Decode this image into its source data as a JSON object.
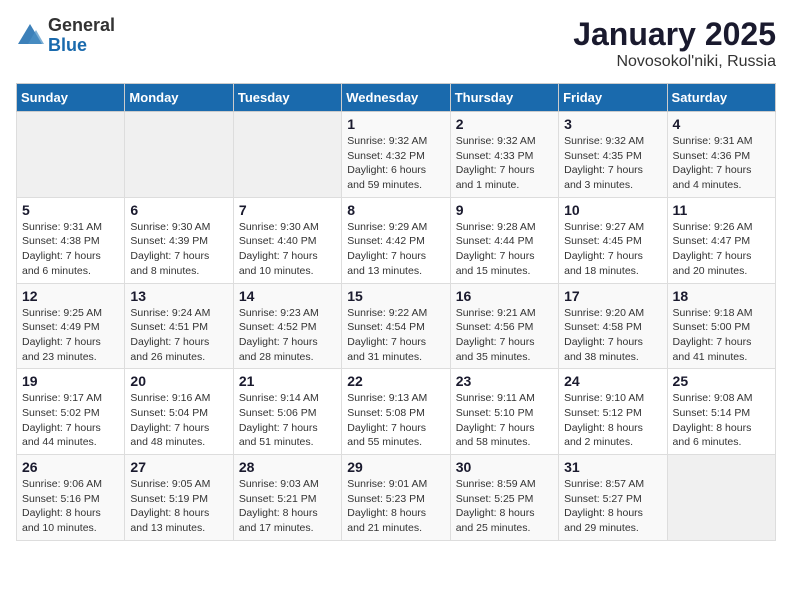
{
  "header": {
    "logo": {
      "general": "General",
      "blue": "Blue"
    },
    "title": "January 2025",
    "subtitle": "Novosokol'niki, Russia"
  },
  "weekdays": [
    "Sunday",
    "Monday",
    "Tuesday",
    "Wednesday",
    "Thursday",
    "Friday",
    "Saturday"
  ],
  "weeks": [
    [
      {
        "day": null
      },
      {
        "day": null
      },
      {
        "day": null
      },
      {
        "day": "1",
        "sunrise": "9:32 AM",
        "sunset": "4:32 PM",
        "daylight": "6 hours and 59 minutes."
      },
      {
        "day": "2",
        "sunrise": "9:32 AM",
        "sunset": "4:33 PM",
        "daylight": "7 hours and 1 minute."
      },
      {
        "day": "3",
        "sunrise": "9:32 AM",
        "sunset": "4:35 PM",
        "daylight": "7 hours and 3 minutes."
      },
      {
        "day": "4",
        "sunrise": "9:31 AM",
        "sunset": "4:36 PM",
        "daylight": "7 hours and 4 minutes."
      }
    ],
    [
      {
        "day": "5",
        "sunrise": "9:31 AM",
        "sunset": "4:38 PM",
        "daylight": "7 hours and 6 minutes."
      },
      {
        "day": "6",
        "sunrise": "9:30 AM",
        "sunset": "4:39 PM",
        "daylight": "7 hours and 8 minutes."
      },
      {
        "day": "7",
        "sunrise": "9:30 AM",
        "sunset": "4:40 PM",
        "daylight": "7 hours and 10 minutes."
      },
      {
        "day": "8",
        "sunrise": "9:29 AM",
        "sunset": "4:42 PM",
        "daylight": "7 hours and 13 minutes."
      },
      {
        "day": "9",
        "sunrise": "9:28 AM",
        "sunset": "4:44 PM",
        "daylight": "7 hours and 15 minutes."
      },
      {
        "day": "10",
        "sunrise": "9:27 AM",
        "sunset": "4:45 PM",
        "daylight": "7 hours and 18 minutes."
      },
      {
        "day": "11",
        "sunrise": "9:26 AM",
        "sunset": "4:47 PM",
        "daylight": "7 hours and 20 minutes."
      }
    ],
    [
      {
        "day": "12",
        "sunrise": "9:25 AM",
        "sunset": "4:49 PM",
        "daylight": "7 hours and 23 minutes."
      },
      {
        "day": "13",
        "sunrise": "9:24 AM",
        "sunset": "4:51 PM",
        "daylight": "7 hours and 26 minutes."
      },
      {
        "day": "14",
        "sunrise": "9:23 AM",
        "sunset": "4:52 PM",
        "daylight": "7 hours and 28 minutes."
      },
      {
        "day": "15",
        "sunrise": "9:22 AM",
        "sunset": "4:54 PM",
        "daylight": "7 hours and 31 minutes."
      },
      {
        "day": "16",
        "sunrise": "9:21 AM",
        "sunset": "4:56 PM",
        "daylight": "7 hours and 35 minutes."
      },
      {
        "day": "17",
        "sunrise": "9:20 AM",
        "sunset": "4:58 PM",
        "daylight": "7 hours and 38 minutes."
      },
      {
        "day": "18",
        "sunrise": "9:18 AM",
        "sunset": "5:00 PM",
        "daylight": "7 hours and 41 minutes."
      }
    ],
    [
      {
        "day": "19",
        "sunrise": "9:17 AM",
        "sunset": "5:02 PM",
        "daylight": "7 hours and 44 minutes."
      },
      {
        "day": "20",
        "sunrise": "9:16 AM",
        "sunset": "5:04 PM",
        "daylight": "7 hours and 48 minutes."
      },
      {
        "day": "21",
        "sunrise": "9:14 AM",
        "sunset": "5:06 PM",
        "daylight": "7 hours and 51 minutes."
      },
      {
        "day": "22",
        "sunrise": "9:13 AM",
        "sunset": "5:08 PM",
        "daylight": "7 hours and 55 minutes."
      },
      {
        "day": "23",
        "sunrise": "9:11 AM",
        "sunset": "5:10 PM",
        "daylight": "7 hours and 58 minutes."
      },
      {
        "day": "24",
        "sunrise": "9:10 AM",
        "sunset": "5:12 PM",
        "daylight": "8 hours and 2 minutes."
      },
      {
        "day": "25",
        "sunrise": "9:08 AM",
        "sunset": "5:14 PM",
        "daylight": "8 hours and 6 minutes."
      }
    ],
    [
      {
        "day": "26",
        "sunrise": "9:06 AM",
        "sunset": "5:16 PM",
        "daylight": "8 hours and 10 minutes."
      },
      {
        "day": "27",
        "sunrise": "9:05 AM",
        "sunset": "5:19 PM",
        "daylight": "8 hours and 13 minutes."
      },
      {
        "day": "28",
        "sunrise": "9:03 AM",
        "sunset": "5:21 PM",
        "daylight": "8 hours and 17 minutes."
      },
      {
        "day": "29",
        "sunrise": "9:01 AM",
        "sunset": "5:23 PM",
        "daylight": "8 hours and 21 minutes."
      },
      {
        "day": "30",
        "sunrise": "8:59 AM",
        "sunset": "5:25 PM",
        "daylight": "8 hours and 25 minutes."
      },
      {
        "day": "31",
        "sunrise": "8:57 AM",
        "sunset": "5:27 PM",
        "daylight": "8 hours and 29 minutes."
      },
      {
        "day": null
      }
    ]
  ]
}
